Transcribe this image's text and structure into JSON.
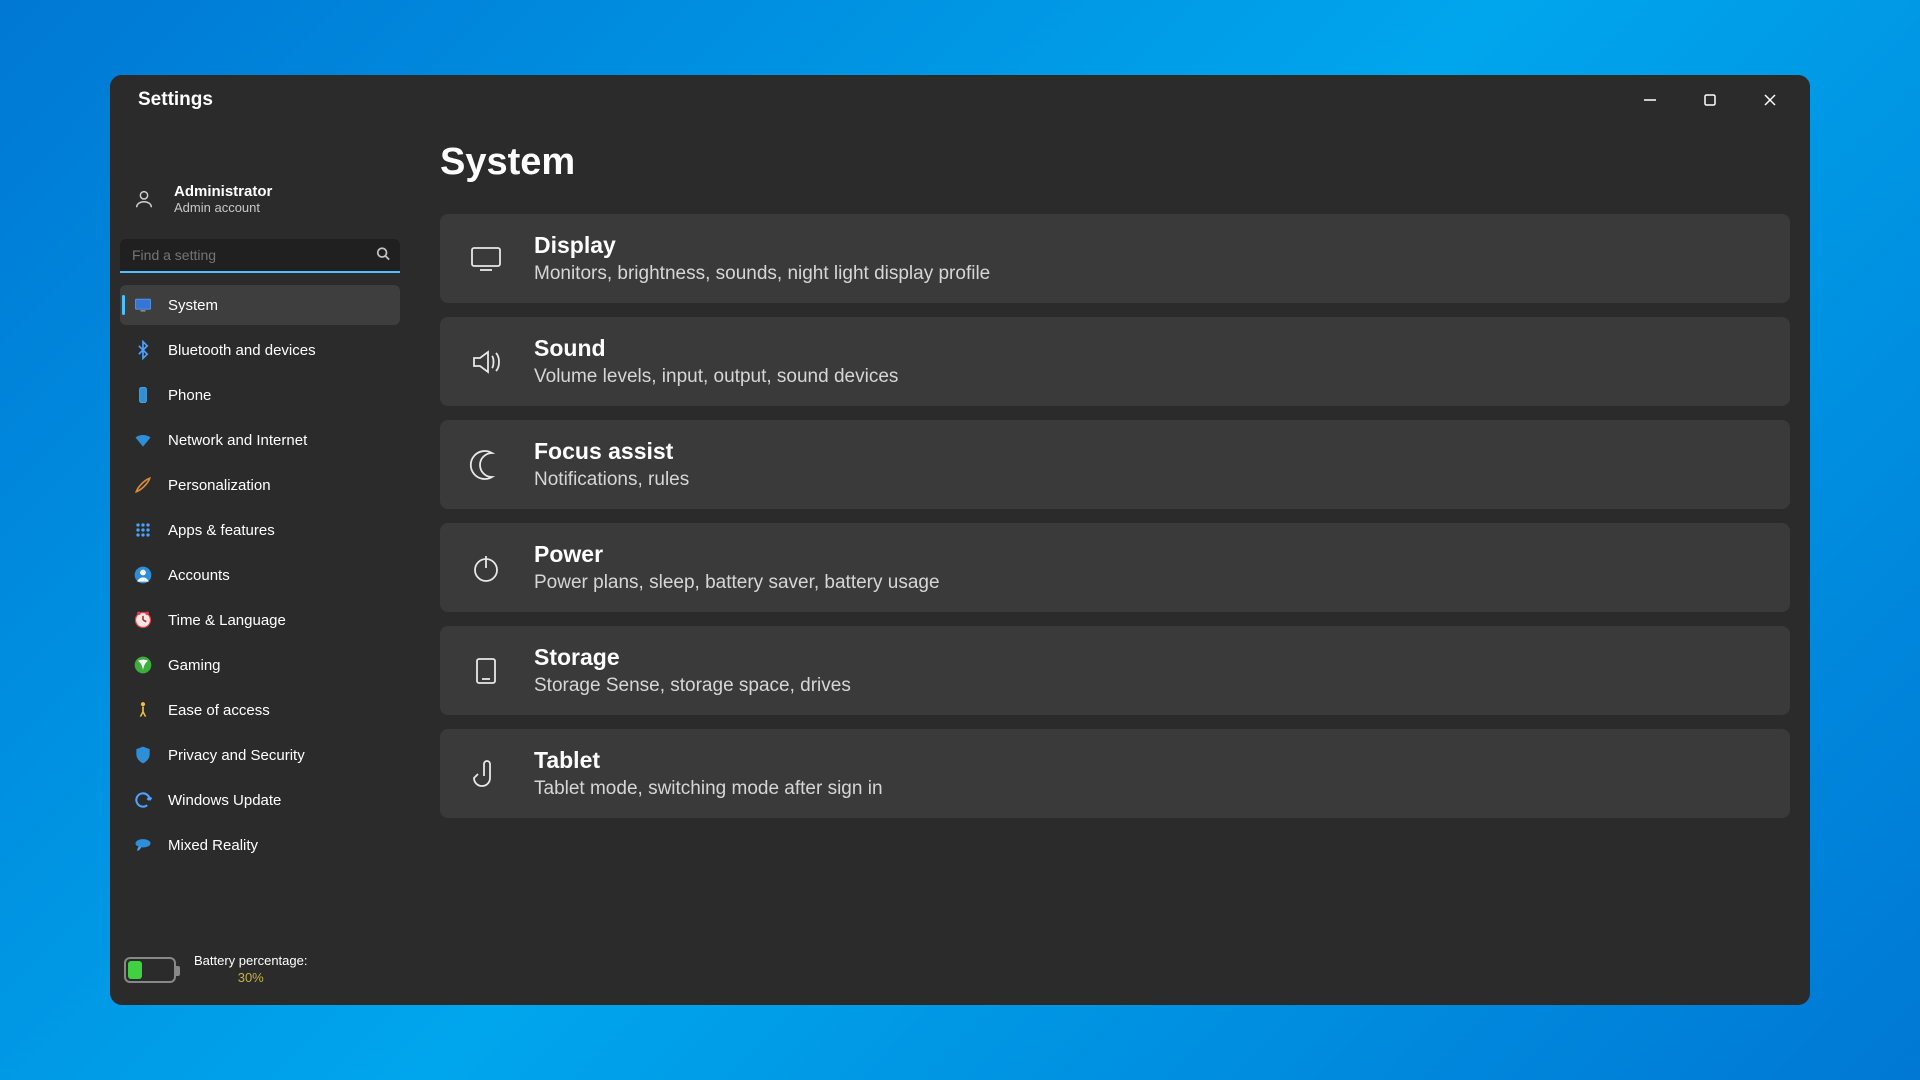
{
  "window_title": "Settings",
  "page_heading": "System",
  "account": {
    "name": "Administrator",
    "sub": "Admin account"
  },
  "search_placeholder": "Find a setting",
  "sidebar": {
    "items": [
      {
        "id": "system",
        "label": "System",
        "active": true
      },
      {
        "id": "bluetooth",
        "label": "Bluetooth and devices"
      },
      {
        "id": "phone",
        "label": "Phone"
      },
      {
        "id": "network",
        "label": "Network and Internet"
      },
      {
        "id": "personalization",
        "label": "Personalization"
      },
      {
        "id": "apps",
        "label": "Apps & features"
      },
      {
        "id": "accounts",
        "label": "Accounts"
      },
      {
        "id": "time",
        "label": "Time & Language"
      },
      {
        "id": "gaming",
        "label": "Gaming"
      },
      {
        "id": "ease",
        "label": "Ease of access"
      },
      {
        "id": "privacy",
        "label": "Privacy and Security"
      },
      {
        "id": "update",
        "label": "Windows Update"
      },
      {
        "id": "mixed",
        "label": "Mixed Reality"
      }
    ]
  },
  "battery": {
    "label": "Battery percentage:",
    "percent_text": "30%",
    "percent_value": 30
  },
  "cards": [
    {
      "id": "display",
      "title": "Display",
      "sub": "Monitors, brightness, sounds, night light display profile"
    },
    {
      "id": "sound",
      "title": "Sound",
      "sub": "Volume levels, input, output, sound devices"
    },
    {
      "id": "focus",
      "title": "Focus assist",
      "sub": "Notifications, rules"
    },
    {
      "id": "power",
      "title": "Power",
      "sub": "Power plans, sleep, battery saver, battery usage"
    },
    {
      "id": "storage",
      "title": "Storage",
      "sub": "Storage Sense, storage space, drives"
    },
    {
      "id": "tablet",
      "title": "Tablet",
      "sub": "Tablet mode, switching mode after sign in"
    }
  ]
}
